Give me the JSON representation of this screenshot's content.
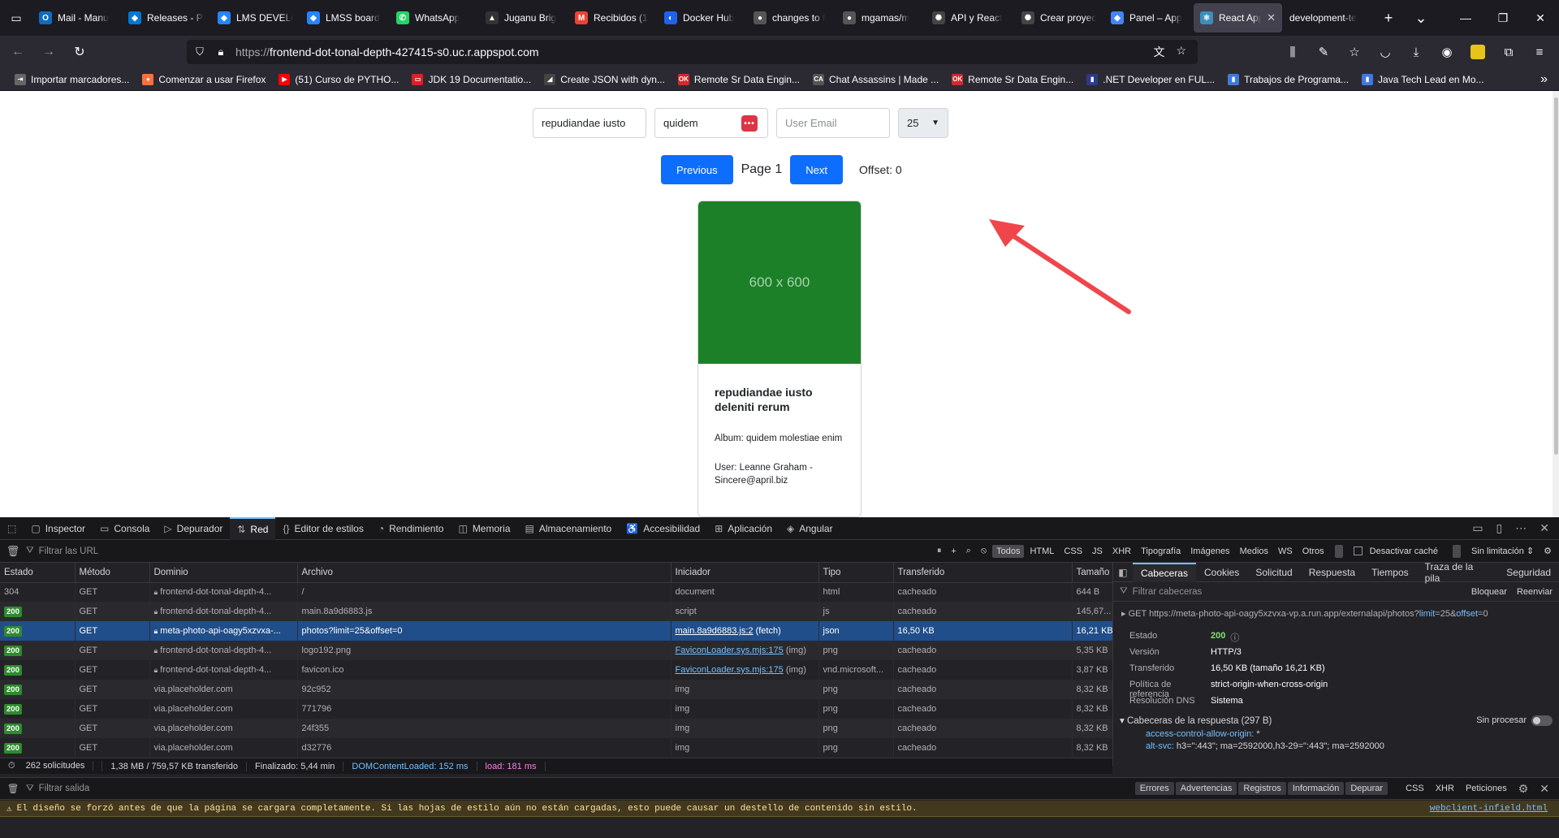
{
  "tabs": [
    {
      "title": "Mail - Manu",
      "color": "#0f6cbd",
      "glyph": "O"
    },
    {
      "title": "Releases - Pi",
      "color": "#0078d4",
      "glyph": "◆"
    },
    {
      "title": "LMS DEVELO",
      "color": "#2684ff",
      "glyph": "◆"
    },
    {
      "title": "LMSS board",
      "color": "#2684ff",
      "glyph": "◆"
    },
    {
      "title": "WhatsApp",
      "color": "#25d366",
      "glyph": "✆"
    },
    {
      "title": "Juganu Brig",
      "color": "#333333",
      "glyph": "▲"
    },
    {
      "title": "Recibidos (1",
      "color": "#ea4335",
      "glyph": "M"
    },
    {
      "title": "Docker Hub",
      "color": "#1d63ed",
      "glyph": "◐"
    },
    {
      "title": "changes to f",
      "color": "#555555",
      "glyph": "●"
    },
    {
      "title": "mgamas/m",
      "color": "#555555",
      "glyph": "●"
    },
    {
      "title": "API y React",
      "color": "#444444",
      "glyph": "✺"
    },
    {
      "title": "Crear proyec",
      "color": "#444444",
      "glyph": "✺"
    },
    {
      "title": "Panel – App",
      "color": "#4285f4",
      "glyph": "◆"
    },
    {
      "title": "React App",
      "color": "#3c8dbc",
      "glyph": "⚛",
      "active": true
    },
    {
      "title": "development-te",
      "color": "#1c1b22",
      "glyph": ""
    }
  ],
  "url": {
    "prefix": "https://",
    "host": "frontend-dot-tonal-depth-427415-s0.uc.r.appspot.com"
  },
  "bookmarks": [
    {
      "label": "Importar marcadores...",
      "color": "#666",
      "glyph": "⇥"
    },
    {
      "label": "Comenzar a usar Firefox",
      "color": "#ff7139",
      "glyph": "●"
    },
    {
      "label": "(51) Curso de PYTHO...",
      "color": "#ff0000",
      "glyph": "▶"
    },
    {
      "label": "JDK 19 Documentatio...",
      "color": "#e11d2a",
      "glyph": "▭"
    },
    {
      "label": "Create JSON with dyn...",
      "color": "#444",
      "glyph": "◢"
    },
    {
      "label": "Remote Sr Data Engin...",
      "color": "#d12a2a",
      "glyph": "OK"
    },
    {
      "label": "Chat Assassins | Made ...",
      "color": "#555",
      "glyph": "CA"
    },
    {
      "label": "Remote Sr Data Engin...",
      "color": "#d12a2a",
      "glyph": "OK"
    },
    {
      "label": ".NET Developer en FUL...",
      "color": "#2b3a8c",
      "glyph": "▮"
    },
    {
      "label": "Trabajos de Programa...",
      "color": "#3d7bd8",
      "glyph": "▮"
    },
    {
      "label": "Java Tech Lead en Mo...",
      "color": "#3d7bd8",
      "glyph": "▮"
    }
  ],
  "page": {
    "filter_title": "repudiandae iusto",
    "filter_album": "quidem",
    "email_placeholder": "User Email",
    "limit": "25",
    "prev_label": "Previous",
    "page_label": "Page 1",
    "next_label": "Next",
    "offset_label": "Offset: 0",
    "card": {
      "image_text": "600 x 600",
      "title": "repudiandae iusto deleniti rerum",
      "album": "Album: quidem molestiae enim",
      "user": "User: Leanne Graham - Sincere@april.biz"
    }
  },
  "devtools": {
    "tabs": [
      {
        "label": "Inspector",
        "icon": "▢"
      },
      {
        "label": "Consola",
        "icon": "▭"
      },
      {
        "label": "Depurador",
        "icon": "▷"
      },
      {
        "label": "Red",
        "icon": "⇅",
        "active": true
      },
      {
        "label": "Editor de estilos",
        "icon": "{}"
      },
      {
        "label": "Rendimiento",
        "icon": "◔"
      },
      {
        "label": "Memoria",
        "icon": "◫"
      },
      {
        "label": "Almacenamiento",
        "icon": "▤"
      },
      {
        "label": "Accesibilidad",
        "icon": "♿"
      },
      {
        "label": "Aplicación",
        "icon": "⊞"
      },
      {
        "label": "Angular",
        "icon": "◈"
      }
    ],
    "filter_urls": "Filtrar las URL",
    "type_filters": [
      "Todos",
      "HTML",
      "CSS",
      "JS",
      "XHR",
      "Tipografía",
      "Imágenes",
      "Medios",
      "WS",
      "Otros"
    ],
    "disable_cache": "Desactivar caché",
    "throttle": "Sin limitación ⇕",
    "columns": [
      "Estado",
      "Método",
      "Dominio",
      "Archivo",
      "Iniciador",
      "Tipo",
      "Transferido",
      "Tamaño"
    ],
    "rows": [
      {
        "status": "304",
        "plain": true,
        "method": "GET",
        "lock": true,
        "domain": "frontend-dot-tonal-depth-4...",
        "file": "/",
        "initiator": "document",
        "link": false,
        "type": "html",
        "transferred": "cacheado",
        "size": "644 B"
      },
      {
        "status": "200",
        "method": "GET",
        "lock": true,
        "domain": "frontend-dot-tonal-depth-4...",
        "file": "main.8a9d6883.js",
        "initiator": "script",
        "link": false,
        "type": "js",
        "transferred": "cacheado",
        "size": "145,67..."
      },
      {
        "status": "200",
        "method": "GET",
        "lock": true,
        "domain": "meta-photo-api-oagy5xzvxa-...",
        "file": "photos?limit=25&offset=0",
        "initiator": "main.8a9d6883.js:2",
        "init_suffix": " (fetch)",
        "link": true,
        "type": "json",
        "transferred": "16,50 KB",
        "size": "16,21 KB",
        "selected": true
      },
      {
        "status": "200",
        "method": "GET",
        "lock": true,
        "domain": "frontend-dot-tonal-depth-4...",
        "file": "logo192.png",
        "initiator": "FaviconLoader.sys.mjs:175",
        "init_suffix": " (img)",
        "link": true,
        "type": "png",
        "transferred": "cacheado",
        "size": "5,35 KB"
      },
      {
        "status": "200",
        "method": "GET",
        "lock": true,
        "domain": "frontend-dot-tonal-depth-4...",
        "file": "favicon.ico",
        "initiator": "FaviconLoader.sys.mjs:175",
        "init_suffix": " (img)",
        "link": true,
        "type": "vnd.microsoft...",
        "transferred": "cacheado",
        "size": "3,87 KB"
      },
      {
        "status": "200",
        "method": "GET",
        "lock": false,
        "domain": "via.placeholder.com",
        "file": "92c952",
        "initiator": "img",
        "link": false,
        "type": "png",
        "transferred": "cacheado",
        "size": "8,32 KB"
      },
      {
        "status": "200",
        "method": "GET",
        "lock": false,
        "domain": "via.placeholder.com",
        "file": "771796",
        "initiator": "img",
        "link": false,
        "type": "png",
        "transferred": "cacheado",
        "size": "8,32 KB"
      },
      {
        "status": "200",
        "method": "GET",
        "lock": false,
        "domain": "via.placeholder.com",
        "file": "24f355",
        "initiator": "img",
        "link": false,
        "type": "png",
        "transferred": "cacheado",
        "size": "8,32 KB"
      },
      {
        "status": "200",
        "method": "GET",
        "lock": false,
        "domain": "via.placeholder.com",
        "file": "d32776",
        "initiator": "img",
        "link": false,
        "type": "png",
        "transferred": "cacheado",
        "size": "8,32 KB"
      }
    ],
    "status": {
      "requests": "262 solicitudes",
      "transferred": "1,38 MB / 759,57 KB transferido",
      "finished": "Finalizado: 5,44 min",
      "dcl": "DOMContentLoaded: 152 ms",
      "load": "load: 181 ms"
    },
    "side_tabs": [
      "Cabeceras",
      "Cookies",
      "Solicitud",
      "Respuesta",
      "Tiempos",
      "Traza de la pila",
      "Seguridad"
    ],
    "filter_headers": "Filtrar cabeceras",
    "block": "Bloquear",
    "resend": "Reenviar",
    "request_line": {
      "method": "GET",
      "base": "https://meta-photo-api-oagy5xzvxa-vp.a.run.app/externalapi/photos?",
      "k1": "limit",
      "v1": "=25&",
      "k2": "offset",
      "v2": "=0"
    },
    "summary": [
      {
        "k": "Estado",
        "v": "200",
        "ok": true
      },
      {
        "k": "Versión",
        "v": "HTTP/3"
      },
      {
        "k": "Transferido",
        "v": "16,50 KB (tamaño 16,21 KB)"
      },
      {
        "k": "Política de referencia",
        "v": "strict-origin-when-cross-origin"
      },
      {
        "k": "Resolución DNS",
        "v": "Sistema"
      }
    ],
    "response_headers_title": "Cabeceras de la respuesta (297 B)",
    "raw": "Sin procesar",
    "headers": [
      {
        "k": "access-control-allow-origin:",
        "v": "*"
      },
      {
        "k": "alt-svc:",
        "v": "h3=\":443\"; ma=2592000,h3-29=\":443\"; ma=2592000"
      }
    ],
    "console_filter": "Filtrar salida",
    "console_cats": [
      "Errores",
      "Advertencias",
      "Registros",
      "Información",
      "Depurar"
    ],
    "console_extra": [
      "CSS",
      "XHR",
      "Peticiones"
    ],
    "warning": "El diseño se forzó antes de que la página se cargara completamente. Si las hojas de estilo aún no están cargadas, esto puede causar un destello de contenido sin estilo.",
    "warning_source": "webclient-infield.html"
  }
}
